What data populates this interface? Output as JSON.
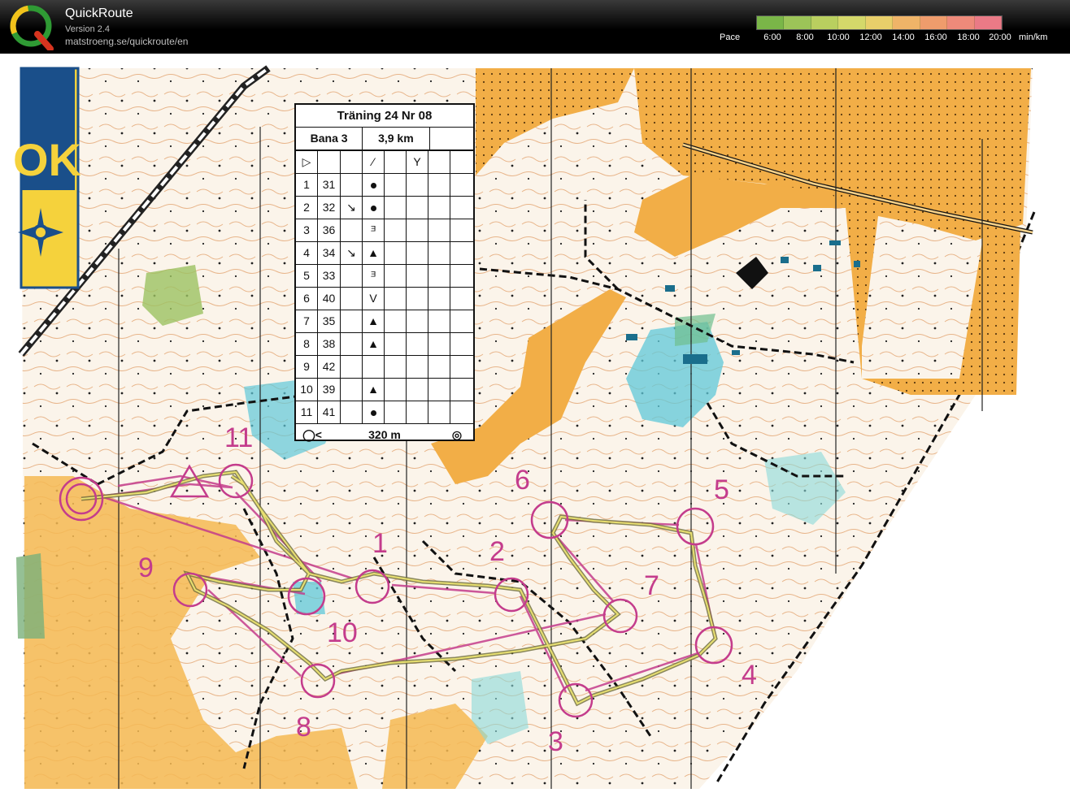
{
  "app": {
    "title": "QuickRoute",
    "version": "Version 2.4",
    "url": "matstroeng.se/quickroute/en"
  },
  "pace_legend": {
    "label": "Pace",
    "ticks": [
      "6:00",
      "8:00",
      "10:00",
      "12:00",
      "14:00",
      "16:00",
      "18:00",
      "20:00"
    ],
    "unit": "min/km",
    "colors": [
      "#7ab648",
      "#9cc458",
      "#b9cf5f",
      "#d4d86a",
      "#e8cf6a",
      "#efb468",
      "#ef9c6c",
      "#ee8a7a",
      "#ea7a86"
    ]
  },
  "control_description": {
    "title": "Träning 24 Nr 08",
    "course": "Bana 3",
    "length": "3,9 km",
    "rows": [
      {
        "num": "1",
        "code": "31",
        "dir": "",
        "symbol": "dot"
      },
      {
        "num": "2",
        "code": "32",
        "dir": "↘",
        "symbol": "dot"
      },
      {
        "num": "3",
        "code": "36",
        "dir": "",
        "symbol": "ᴲ"
      },
      {
        "num": "4",
        "code": "34",
        "dir": "↘",
        "symbol": "▲"
      },
      {
        "num": "5",
        "code": "33",
        "dir": "",
        "symbol": "ᴲ"
      },
      {
        "num": "6",
        "code": "40",
        "dir": "",
        "symbol": "V"
      },
      {
        "num": "7",
        "code": "35",
        "dir": "",
        "symbol": "▲"
      },
      {
        "num": "8",
        "code": "38",
        "dir": "",
        "symbol": "▲"
      },
      {
        "num": "9",
        "code": "42",
        "dir": "",
        "symbol": ""
      },
      {
        "num": "10",
        "code": "39",
        "dir": "",
        "symbol": "▲"
      },
      {
        "num": "11",
        "code": "41",
        "dir": "",
        "symbol": "dot"
      }
    ],
    "finish_distance": "320 m"
  },
  "map_labels": {
    "club_logo_text": "OK"
  },
  "controls": [
    {
      "label": "1"
    },
    {
      "label": "2"
    },
    {
      "label": "3"
    },
    {
      "label": "4"
    },
    {
      "label": "5"
    },
    {
      "label": "6"
    },
    {
      "label": "7"
    },
    {
      "label": "8"
    },
    {
      "label": "9"
    },
    {
      "label": "10"
    },
    {
      "label": "11"
    }
  ],
  "colors": {
    "course": "#c43c8c",
    "route": "#e8e070",
    "open_land": "#f3b14a",
    "water": "#5fc8d8",
    "paper": "#ffffff"
  }
}
